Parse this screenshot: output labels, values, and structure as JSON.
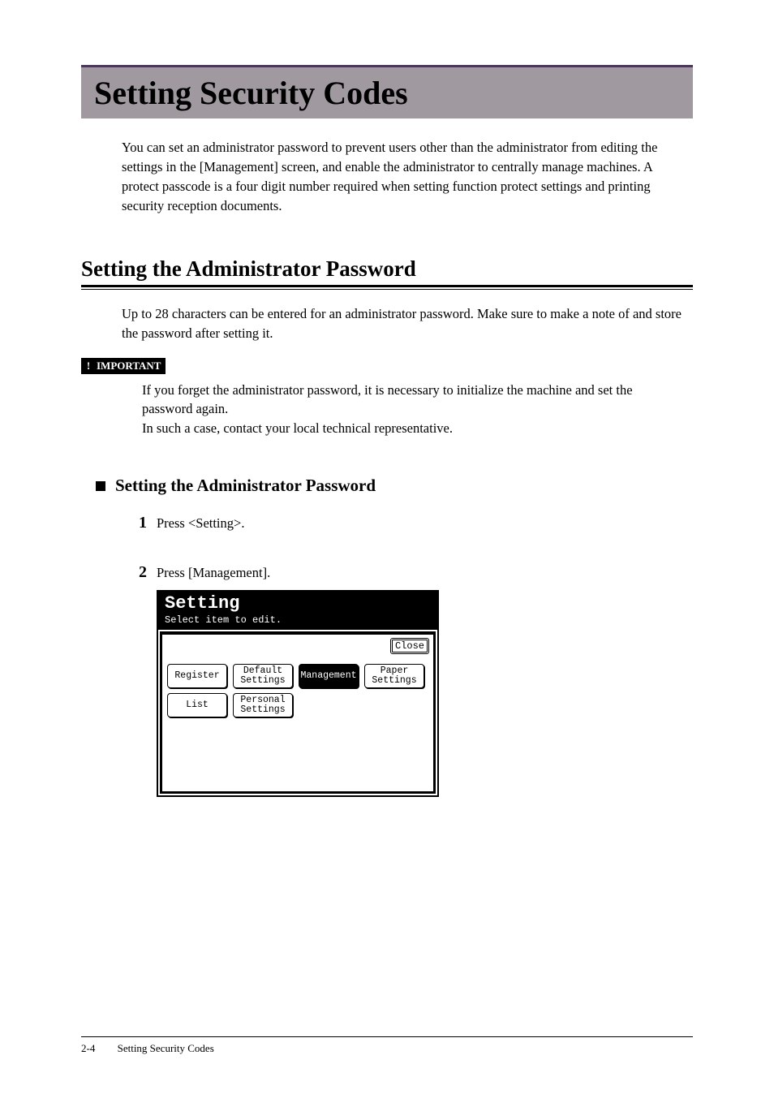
{
  "page": {
    "main_title": "Setting Security Codes",
    "intro": "You can set an administrator password to prevent users other than the administrator from editing the settings in the [Management] screen, and enable the administrator to centrally manage machines. A protect passcode is a four digit number required when setting function protect settings and printing security reception documents.",
    "section_title": "Setting the Administrator Password",
    "section_text": "Up to 28 characters can be entered for an administrator password. Make sure to make a note of and store the password after setting it.",
    "important_label": "IMPORTANT",
    "important_text_1": "If you forget the administrator password, it is necessary to initialize the machine and set the password again.",
    "important_text_2": "In such a case, contact your local technical representative.",
    "sub_heading": "Setting the Administrator Password",
    "steps": [
      {
        "num": "1",
        "text": "Press <Setting>."
      },
      {
        "num": "2",
        "text": "Press [Management]."
      }
    ],
    "screen": {
      "title": "Setting",
      "subtitle": "Select item to edit.",
      "close": "Close",
      "buttons": {
        "register": "Register",
        "default_settings": "Default\nSettings",
        "management": "Management",
        "paper_settings": "Paper\nSettings",
        "list": "List",
        "personal_settings": "Personal\nSettings"
      }
    },
    "footer_page": "2-4",
    "footer_title": "Setting Security Codes"
  }
}
